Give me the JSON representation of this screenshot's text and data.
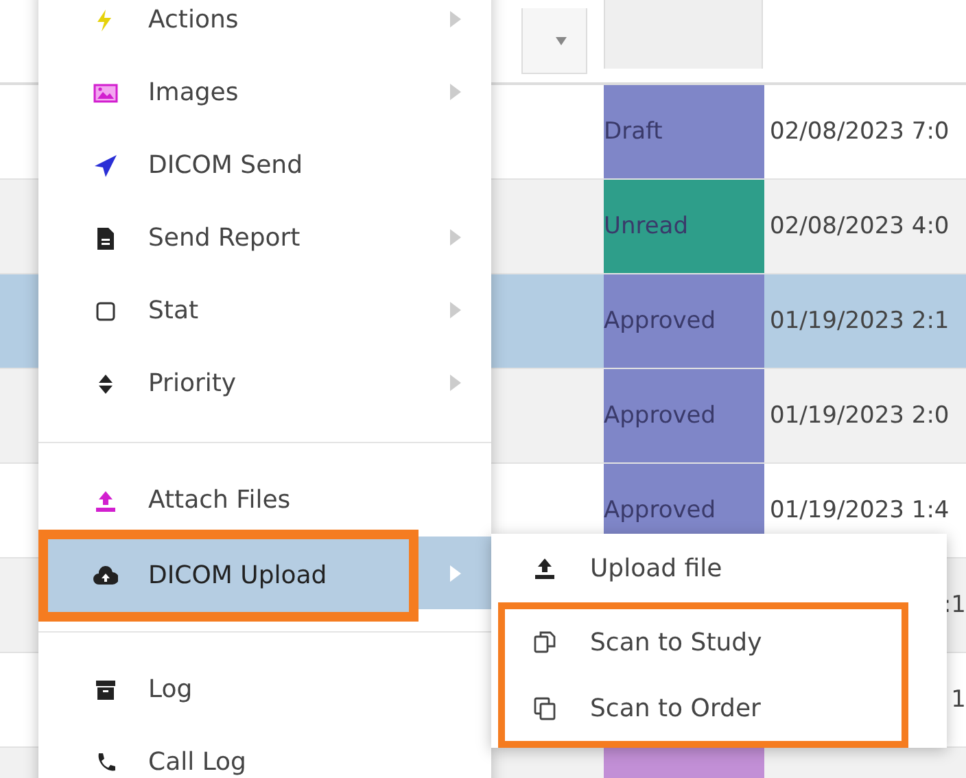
{
  "table": {
    "rows": [
      {
        "status": "Draft",
        "color": "#7f86c8",
        "date": "02/08/2023 7:0",
        "selected": false
      },
      {
        "status": "Unread",
        "color": "#2e9e8a",
        "date": "02/08/2023 4:0",
        "selected": false
      },
      {
        "status": "Approved",
        "color": "#7f86c8",
        "date": "01/19/2023 2:1",
        "selected": true
      },
      {
        "status": "Approved",
        "color": "#7f86c8",
        "date": "01/19/2023 2:0",
        "selected": false
      },
      {
        "status": "Approved",
        "color": "#7f86c8",
        "date": "01/19/2023 1:4",
        "selected": false
      },
      {
        "date": ":1",
        "selected": false
      },
      {
        "date": "1",
        "selected": false
      },
      {
        "color": "#c28fd6",
        "selected": false
      }
    ]
  },
  "context_menu": {
    "groups": [
      [
        {
          "label": "Actions",
          "has_submenu": true,
          "selected": false,
          "highlighted": false
        },
        {
          "label": "Images",
          "has_submenu": true,
          "selected": false,
          "highlighted": false
        },
        {
          "label": "DICOM Send",
          "has_submenu": false,
          "selected": false,
          "highlighted": false
        },
        {
          "label": "Send Report",
          "has_submenu": true,
          "selected": false,
          "highlighted": false
        },
        {
          "label": "Stat",
          "has_submenu": true,
          "selected": false,
          "highlighted": false
        },
        {
          "label": "Priority",
          "has_submenu": true,
          "selected": false,
          "highlighted": false
        }
      ],
      [
        {
          "label": "Attach Files",
          "has_submenu": false,
          "selected": false,
          "highlighted": false
        },
        {
          "label": "DICOM Upload",
          "has_submenu": true,
          "selected": true,
          "highlighted": true
        }
      ],
      [
        {
          "label": "Log",
          "has_submenu": false,
          "selected": false,
          "highlighted": false
        },
        {
          "label": "Call Log",
          "has_submenu": false,
          "selected": false,
          "highlighted": false
        }
      ]
    ]
  },
  "submenu": {
    "items": [
      {
        "label": "Upload file",
        "highlighted": false
      },
      {
        "label": "Scan to Study",
        "highlighted": true
      },
      {
        "label": "Scan to Order",
        "highlighted": true
      }
    ]
  }
}
